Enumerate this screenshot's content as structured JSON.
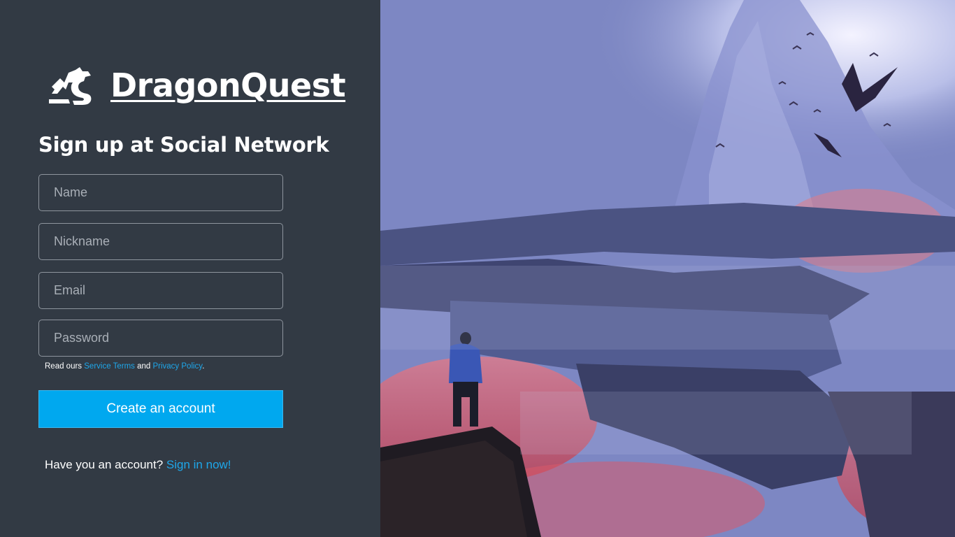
{
  "brand": {
    "name": "DragonQuest",
    "icon": "dragon-logo-icon"
  },
  "signup": {
    "title": "Sign up at Social Network",
    "fields": {
      "name_placeholder": "Name",
      "nickname_placeholder": "Nickname",
      "email_placeholder": "Email",
      "password_placeholder": "Password"
    },
    "terms": {
      "prefix": "Read ours ",
      "service_terms": "Service Terms",
      "middle": " and ",
      "privacy_policy": "Privacy Policy",
      "suffix": "."
    },
    "create_button": "Create an account",
    "signin_prompt": "Have you an account? ",
    "signin_link": "Sign in now!"
  },
  "colors": {
    "panel_bg": "#323a44",
    "accent": "#00a8ef",
    "link": "#1ea7ea"
  },
  "hero": {
    "scene": "hero-artwork"
  }
}
